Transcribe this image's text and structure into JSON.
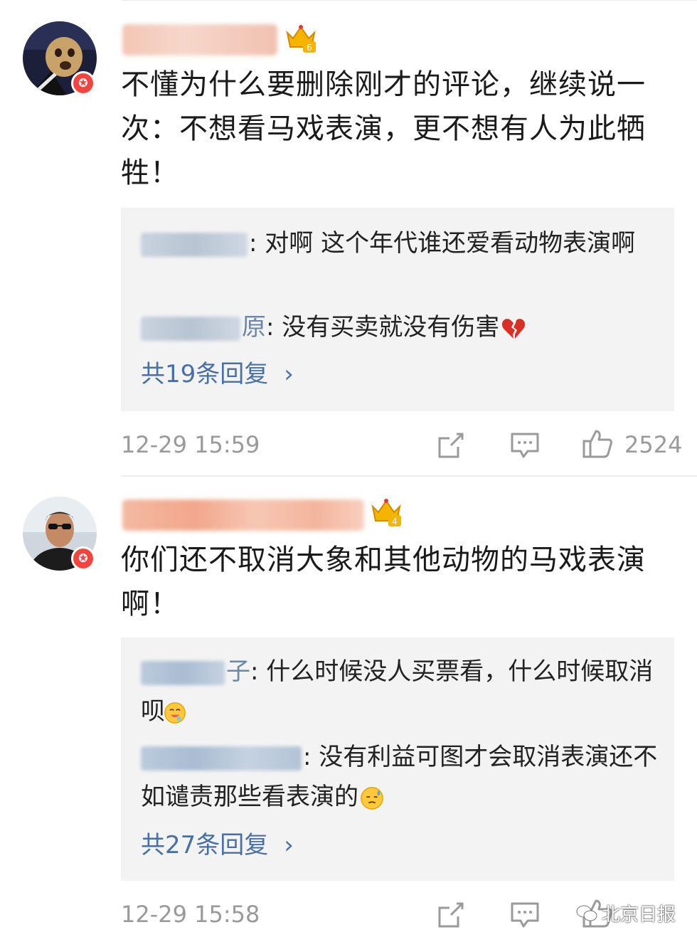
{
  "comments": [
    {
      "text": "不懂为什么要删除刚才的评论，继续说一次：不想看马戏表演，更不想有人为此牺牲！",
      "crown_level": "6",
      "replies": [
        {
          "text": ": 对啊 这个年代谁还爱看动物表演啊"
        },
        {
          "name_suffix": "原",
          "text": ": 没有买卖就没有伤害"
        }
      ],
      "more_replies": "共19条回复",
      "time": "12-29 15:59",
      "likes": "2524"
    },
    {
      "text": "你们还不取消大象和其他动物的马戏表演啊！",
      "crown_level": "4",
      "replies": [
        {
          "name_suffix": "子",
          "text": ": 什么时候没人买票看，什么时候取消呗"
        },
        {
          "text": ": 没有利益可图才会取消表演还不如谴责那些看表演的"
        }
      ],
      "more_replies": "共27条回复",
      "time": "12-29 15:58"
    }
  ],
  "watermark": "北京日报",
  "colors": {
    "link": "#4a6fa5",
    "meta": "#9a9a9a",
    "reply_bg": "#f3f3f3",
    "badge": "#f0463f"
  },
  "icons": [
    "crown-icon",
    "verified-badge-icon",
    "share-icon",
    "comment-icon",
    "like-icon",
    "broken-heart-icon",
    "drool-face-icon",
    "sweat-face-icon",
    "wechat-logo-icon"
  ]
}
